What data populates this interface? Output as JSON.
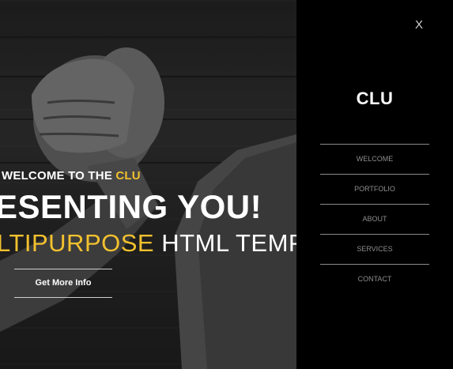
{
  "hero": {
    "welcome_prefix": "WELCOME TO THE ",
    "welcome_accent": "CLU",
    "headline": "ESENTING YOU!",
    "sub_accent": "LTIPURPOSE",
    "sub_rest": " HTML TEMP",
    "cta_label": "Get More Info",
    "accent_color": "#f2c12e"
  },
  "menu": {
    "close_label": "X",
    "brand": "CLU",
    "items": [
      {
        "label": "WELCOME"
      },
      {
        "label": "PORTFOLIO"
      },
      {
        "label": "ABOUT"
      },
      {
        "label": "SERVICES"
      },
      {
        "label": "CONTACT"
      }
    ]
  }
}
